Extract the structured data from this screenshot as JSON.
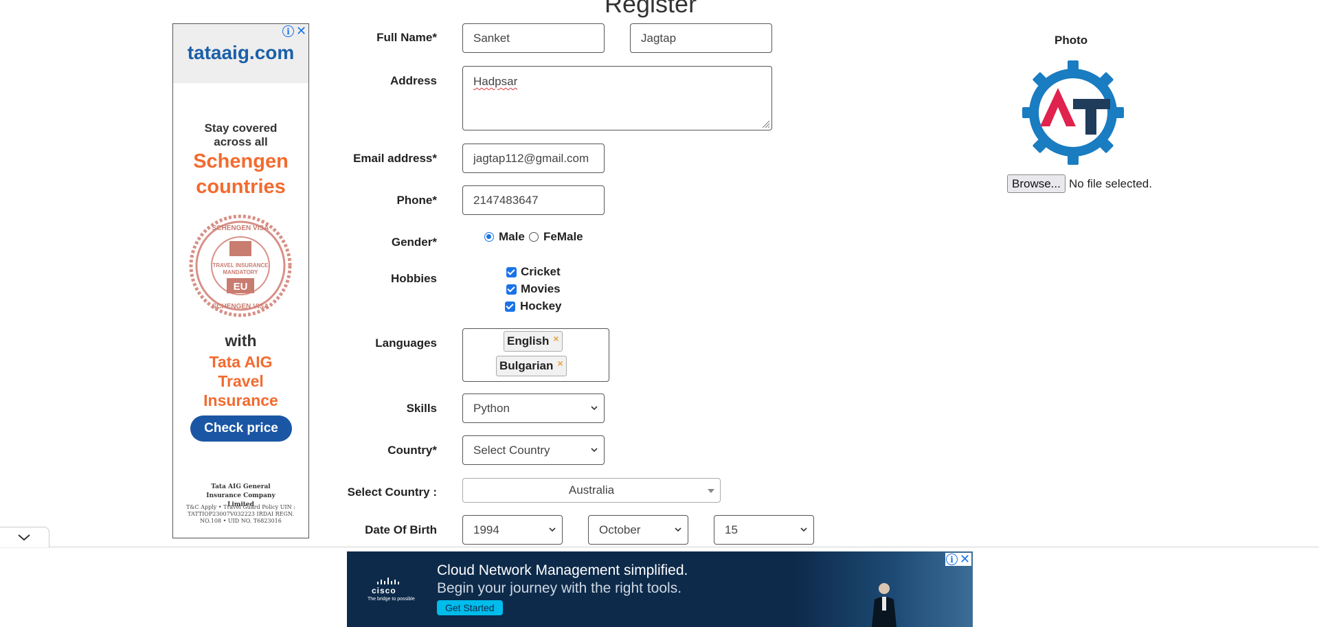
{
  "page": {
    "title": "Register"
  },
  "left_ad": {
    "domain": "tataaig.com",
    "line1": "Stay covered across all",
    "line2": "Schengen countries",
    "line3": "with",
    "line4": "Tata AIG Travel Insurance",
    "cta": "Check price",
    "fine1": "Tata AIG General Insurance Company Limited",
    "fine2": "T&C Apply • Travel Guard Policy UIN : TATTIOP23007V032223 IRDAI REGN. NO.108 • UID NO. T6823016",
    "stamp_text": "SCHENGEN VISA · TRAVEL INSURANCE MANDATORY · EU",
    "info_icon": "i",
    "close_icon": "✕"
  },
  "form": {
    "full_name_label": "Full Name*",
    "first_name": "Sanket",
    "last_name": "Jagtap",
    "address_label": "Address",
    "address": "Hadpsar",
    "email_label": "Email address*",
    "email": "jagtap112@gmail.com",
    "phone_label": "Phone*",
    "phone": "2147483647",
    "gender_label": "Gender*",
    "gender_options": [
      "Male",
      "FeMale"
    ],
    "gender_selected": "Male",
    "hobbies_label": "Hobbies",
    "hobbies": [
      "Cricket",
      "Movies",
      "Hockey"
    ],
    "languages_label": "Languages",
    "languages": [
      "English",
      "Bulgarian"
    ],
    "tag_remove_icon": "×",
    "skills_label": "Skills",
    "skills": "Python",
    "country_label": "Country*",
    "country": "Select Country",
    "select_country_label": "Select Country :",
    "select_country": "Australia",
    "dob_label": "Date Of Birth",
    "dob_year": "1994",
    "dob_month": "October",
    "dob_day": "15"
  },
  "photo": {
    "title": "Photo",
    "browse": "Browse...",
    "status": "No file selected.",
    "logo_colors": {
      "gear": "#1a7cc1",
      "a": "#e0234e",
      "t": "#1f3c5a"
    }
  },
  "bottom_ad": {
    "brand": "cisco",
    "tagline": "The bridge to possible",
    "headline": "Cloud Network Management simplified.",
    "subline": "Begin your journey with the right tools.",
    "cta": "Get Started",
    "info_icon": "i",
    "close_icon": "✕"
  }
}
